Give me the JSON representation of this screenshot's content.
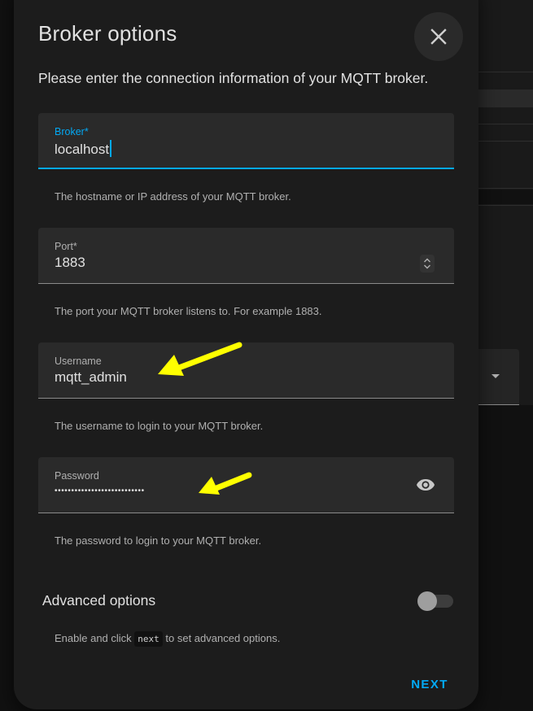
{
  "dialog": {
    "title": "Broker options",
    "description": "Please enter the connection information of your MQTT broker.",
    "close_icon": "close-icon"
  },
  "fields": {
    "broker": {
      "label": "Broker*",
      "value": "localhost",
      "helper": "The hostname or IP address of your MQTT broker."
    },
    "port": {
      "label": "Port*",
      "value": "1883",
      "helper": "The port your MQTT broker listens to. For example 1883.",
      "stepper_icon": "chevron-up-down-icon"
    },
    "username": {
      "label": "Username",
      "value": "mqtt_admin",
      "helper": "The username to login to your MQTT broker."
    },
    "password": {
      "label": "Password",
      "value": "•••••••••••••••••••••••••••",
      "helper": "The password to login to your MQTT broker.",
      "reveal_icon": "eye-icon"
    }
  },
  "advanced": {
    "label": "Advanced options",
    "enabled": false,
    "helper_before": "Enable and click ",
    "helper_code": "next",
    "helper_after": " to set advanced options."
  },
  "actions": {
    "next_label": "NEXT"
  },
  "colors": {
    "accent": "#03a9f4",
    "surface": "#1c1c1c",
    "field_bg": "#2a2a2a",
    "annotation": "#ffff00"
  }
}
